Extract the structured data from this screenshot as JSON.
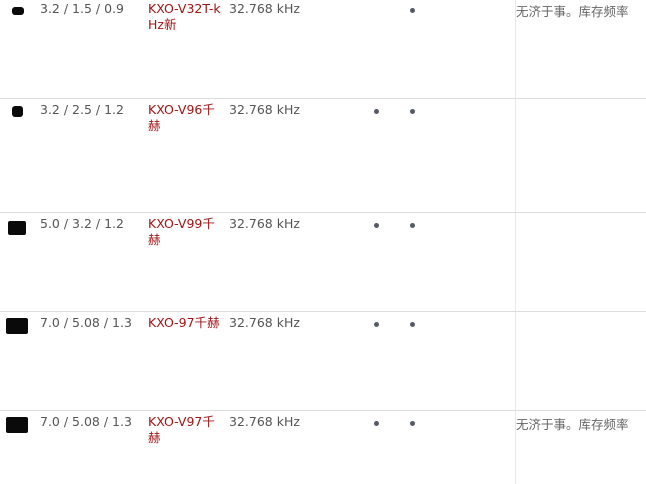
{
  "rows": [
    {
      "size": "3.2 / 1.5 / 0.9",
      "model": "KXO-V32T-kHz新",
      "frequency": "32.768 kHz",
      "dot1": false,
      "dot2": true,
      "note": "无济于事。库存频率"
    },
    {
      "size": "3.2 / 2.5 / 1.2",
      "model": "KXO-V96千赫",
      "frequency": "32.768 kHz",
      "dot1": true,
      "dot2": true,
      "note": ""
    },
    {
      "size": "5.0 / 3.2 / 1.2",
      "model": "KXO-V99千赫",
      "frequency": "32.768 kHz",
      "dot1": true,
      "dot2": true,
      "note": ""
    },
    {
      "size": "7.0 / 5.08 / 1.3",
      "model": "KXO-97千赫",
      "frequency": "32.768 kHz",
      "dot1": true,
      "dot2": true,
      "note": ""
    },
    {
      "size": "7.0 / 5.08 / 1.3",
      "model": "KXO-V97千赫",
      "frequency": "32.768 kHz",
      "dot1": true,
      "dot2": true,
      "note": "无济于事。库存频率"
    }
  ],
  "icons": {
    "product_image": "crystal-oscillator-chip-icon",
    "availability": "bullet-dot-icon"
  },
  "colors": {
    "link": "#a01414",
    "text": "#555555",
    "divider": "#dcdcdc",
    "chip": "#0a0a0a",
    "dot": "#555a66"
  }
}
